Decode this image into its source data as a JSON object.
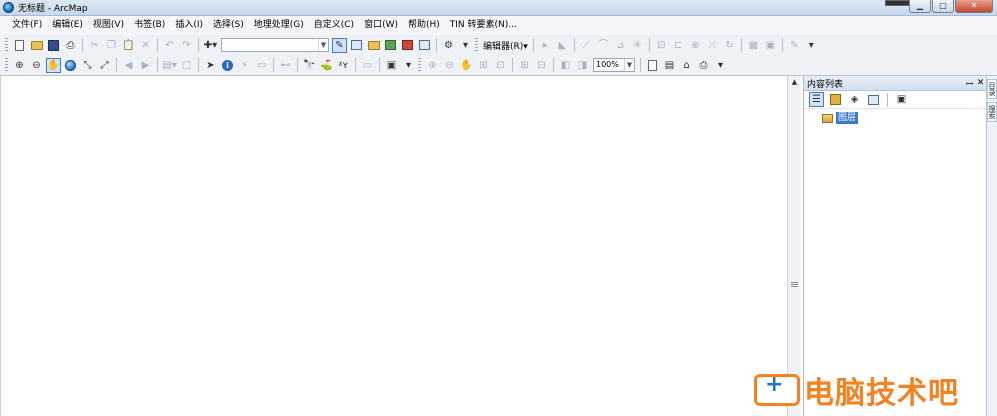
{
  "window": {
    "title": "无标题 - ArcMap",
    "buttons": {
      "minimize": "▁",
      "maximize": "□",
      "close": "✕"
    }
  },
  "menubar": {
    "items": [
      "文件(F)",
      "编辑(E)",
      "视图(V)",
      "书签(B)",
      "插入(I)",
      "选择(S)",
      "地理处理(G)",
      "自定义(C)",
      "窗口(W)",
      "帮助(H)",
      "TIN 转要素(N)..."
    ]
  },
  "toolbar1": {
    "editor_label": "编辑器(R)▾",
    "scale_combo_value": ""
  },
  "toolbar2": {
    "zoom_value": "100%"
  },
  "toc": {
    "title": "内容列表",
    "pin": "ꟷ",
    "close": "✕",
    "layer_label": "图层"
  },
  "right_dock": {
    "tab1": "目录",
    "tab2": "搜索"
  },
  "watermark": {
    "text": "电脑技术吧"
  },
  "colors": {
    "toolbar_bg": "#eef2f7",
    "selection": "#3a78c8",
    "watermark": "#f58220"
  }
}
